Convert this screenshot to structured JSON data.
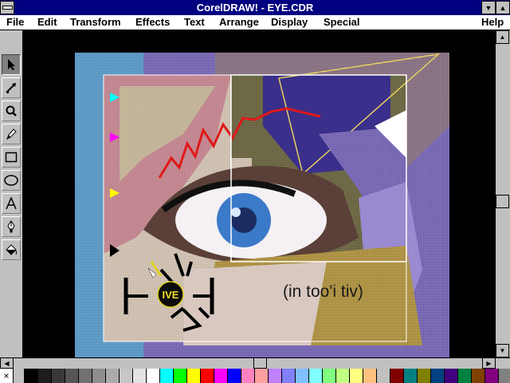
{
  "window": {
    "title": "CorelDRAW! - EYE.CDR"
  },
  "menu": [
    "File",
    "Edit",
    "Transform",
    "Effects",
    "Text",
    "Arrange",
    "Display",
    "Special",
    "Help"
  ],
  "tools": [
    {
      "name": "pick-tool-icon"
    },
    {
      "name": "shape-tool-icon"
    },
    {
      "name": "zoom-tool-icon"
    },
    {
      "name": "pencil-tool-icon"
    },
    {
      "name": "rectangle-tool-icon"
    },
    {
      "name": "ellipse-tool-icon"
    },
    {
      "name": "text-tool-icon"
    },
    {
      "name": "outline-tool-icon"
    },
    {
      "name": "fill-tool-icon"
    }
  ],
  "artwork": {
    "logo_text": "IVE",
    "caption": "(in too'i tiv)"
  },
  "palette": {
    "no_color": "×",
    "colors": [
      "#000000",
      "#1c1c1c",
      "#383838",
      "#555555",
      "#717171",
      "#8e8e8e",
      "#aaaaaa",
      "#c6c6c6",
      "#e3e3e3",
      "#ffffff",
      "#00ffff",
      "#00ff00",
      "#ffff00",
      "#ff0000",
      "#ff00ff",
      "#0000ff",
      "#ff80c0",
      "#ffa0a0",
      "#c080ff",
      "#8080ff",
      "#80c0ff",
      "#80ffff",
      "#80ff80",
      "#c0ff80",
      "#ffff80",
      "#ffc080",
      "#c0c0c0",
      "#800000",
      "#008080",
      "#808000",
      "#004080",
      "#400080",
      "#008040",
      "#804000",
      "#800080"
    ]
  }
}
